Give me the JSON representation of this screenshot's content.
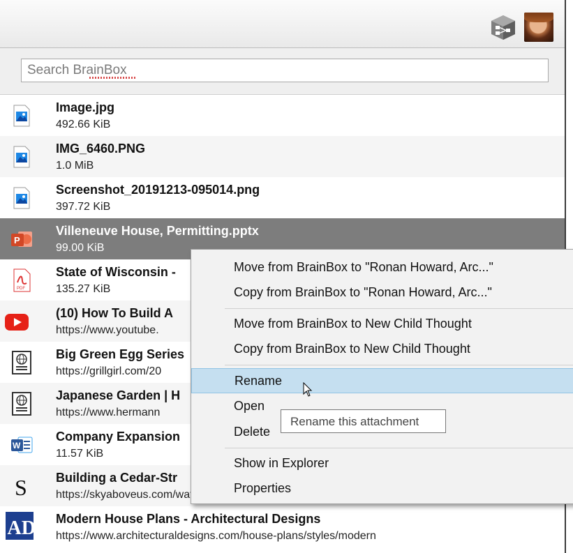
{
  "header": {
    "brain_icon": "brainbox-cube-icon",
    "avatar": "user-avatar"
  },
  "search": {
    "placeholder": "Search BrainBox"
  },
  "items": [
    {
      "name": "Image.jpg",
      "sub": "492.66 KiB",
      "icon": "image-file-icon"
    },
    {
      "name": "IMG_6460.PNG",
      "sub": "1.0 MiB",
      "icon": "image-file-icon"
    },
    {
      "name": "Screenshot_20191213-095014.png",
      "sub": "397.72 KiB",
      "icon": "image-file-icon"
    },
    {
      "name": "Villeneuve House, Permitting.pptx",
      "sub": "99.00 KiB",
      "icon": "powerpoint-icon"
    },
    {
      "name": "State of Wisconsin -",
      "sub": "135.27 KiB",
      "icon": "pdf-icon"
    },
    {
      "name": "(10) How To Build A",
      "sub": "https://www.youtube.",
      "icon": "youtube-icon"
    },
    {
      "name": "Big Green Egg Series",
      "sub": "https://grillgirl.com/20",
      "icon": "web-page-icon"
    },
    {
      "name": "Japanese Garden | H",
      "sub": "https://www.hermann",
      "icon": "web-page-icon"
    },
    {
      "name": "Company Expansion",
      "sub": "11.57 KiB",
      "icon": "word-icon"
    },
    {
      "name": "Building a Cedar-Str",
      "sub": "https://skyaboveus.com/water-sports/Building-a-Cedar-Strip-Canoe-The-Basics",
      "icon": "site-favicon-s-icon"
    },
    {
      "name": "Modern House Plans - Architectural Designs",
      "sub": "https://www.architecturaldesigns.com/house-plans/styles/modern",
      "icon": "site-favicon-ad-icon"
    }
  ],
  "context_menu": {
    "items": [
      "Move from BrainBox to \"Ronan Howard, Arc...\"",
      "Copy from BrainBox to \"Ronan Howard, Arc...\"",
      "Move from BrainBox to New Child Thought",
      "Copy from BrainBox to New Child Thought",
      "Rename",
      "Open",
      "Delete",
      "Show in Explorer",
      "Properties"
    ],
    "highlighted": "Rename"
  },
  "tooltip": {
    "text": "Rename this attachment"
  },
  "colors": {
    "selected_row": "#7d7d7d",
    "menu_highlight": "#c5dff0",
    "pptx_orange": "#d24726",
    "word_blue": "#2b579a",
    "youtube_red": "#e62117"
  }
}
